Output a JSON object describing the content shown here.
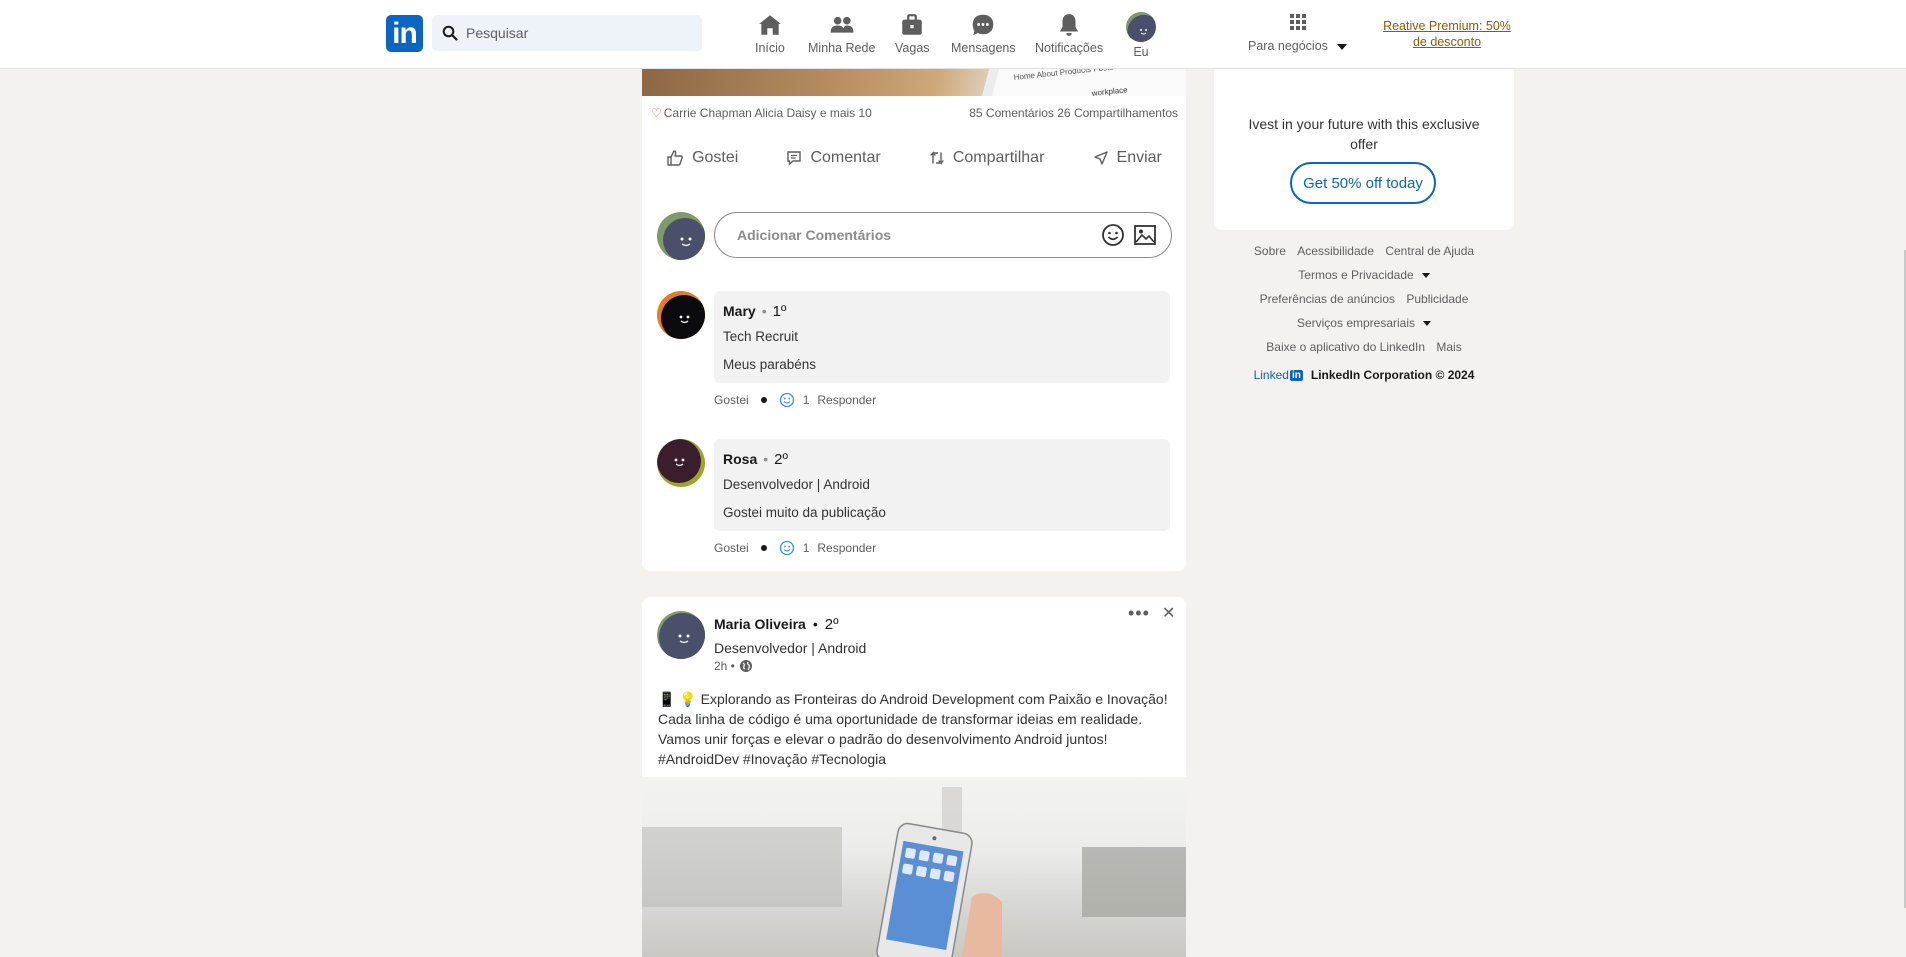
{
  "header": {
    "logo_text": "in",
    "search_placeholder": "Pesquisar",
    "nav": [
      {
        "label": "Início",
        "icon": "home-icon"
      },
      {
        "label": "Minha Rede",
        "icon": "network-icon"
      },
      {
        "label": "Vagas",
        "icon": "jobs-icon"
      },
      {
        "label": "Mensagens",
        "icon": "messaging-icon"
      },
      {
        "label": "Notificações",
        "icon": "notifications-icon"
      },
      {
        "label": "Eu",
        "icon": "avatar"
      }
    ],
    "business_label": "Para negócios",
    "premium_text": "Reative Premium: 50% de desconto"
  },
  "post1": {
    "reactions_text": "Carrie Chapman Alicia Daisy e mais 10",
    "stats_text": "85 Comentários 26 Compartilhamentos",
    "actions": [
      "Gostei",
      "Comentar",
      "Compartilhar",
      "Enviar"
    ],
    "comment_placeholder": "Adicionar Comentários",
    "comments": [
      {
        "name": "Mary",
        "degree": "1º",
        "title": "Tech Recruit",
        "text": "Meus parabéns",
        "like_label": "Gostei",
        "reaction_count": "1",
        "reply_label": "Responder"
      },
      {
        "name": "Rosa",
        "degree": "2º",
        "title": "Desenvolvedor | Android",
        "text": "Gostei muito da publicação",
        "like_label": "Gostei",
        "reaction_count": "1",
        "reply_label": "Responder"
      }
    ]
  },
  "post2": {
    "author": "Maria Oliveira",
    "degree": "2º",
    "subtitle": "Desenvolvedor | Android",
    "time": "2h •",
    "text_lines": [
      "📱 💡 Explorando as Fronteiras do Android Development com Paixão e Inovação!",
      "Cada linha de código é uma oportunidade de transformar ideias em realidade.",
      "Vamos unir forças e elevar o padrão do desenvolvimento Android juntos!",
      "#AndroidDev #Inovação #Tecnologia"
    ],
    "more_symbol": "•••",
    "close_symbol": "✕"
  },
  "sidebar": {
    "promo_text": "Ivest in your future with this exclusive offer",
    "promo_button": "Get 50% off today",
    "footer_rows": [
      [
        "Sobre",
        "Acessibilidade",
        "Central de Ajuda"
      ],
      [
        "Termos e Privacidade"
      ],
      [
        "Preferências de anúncios",
        "Publicidade"
      ],
      [
        "Serviços empresariais"
      ],
      [
        "Baixe o aplicativo do LinkedIn",
        "Mais"
      ]
    ],
    "footer_logo_text": "Linked",
    "footer_logo_in": "in",
    "copyright": "LinkedIn Corporation © 2024"
  },
  "colors": {
    "brand": "#0a66c2",
    "premium": "#915907",
    "background": "#f4f2ee"
  }
}
